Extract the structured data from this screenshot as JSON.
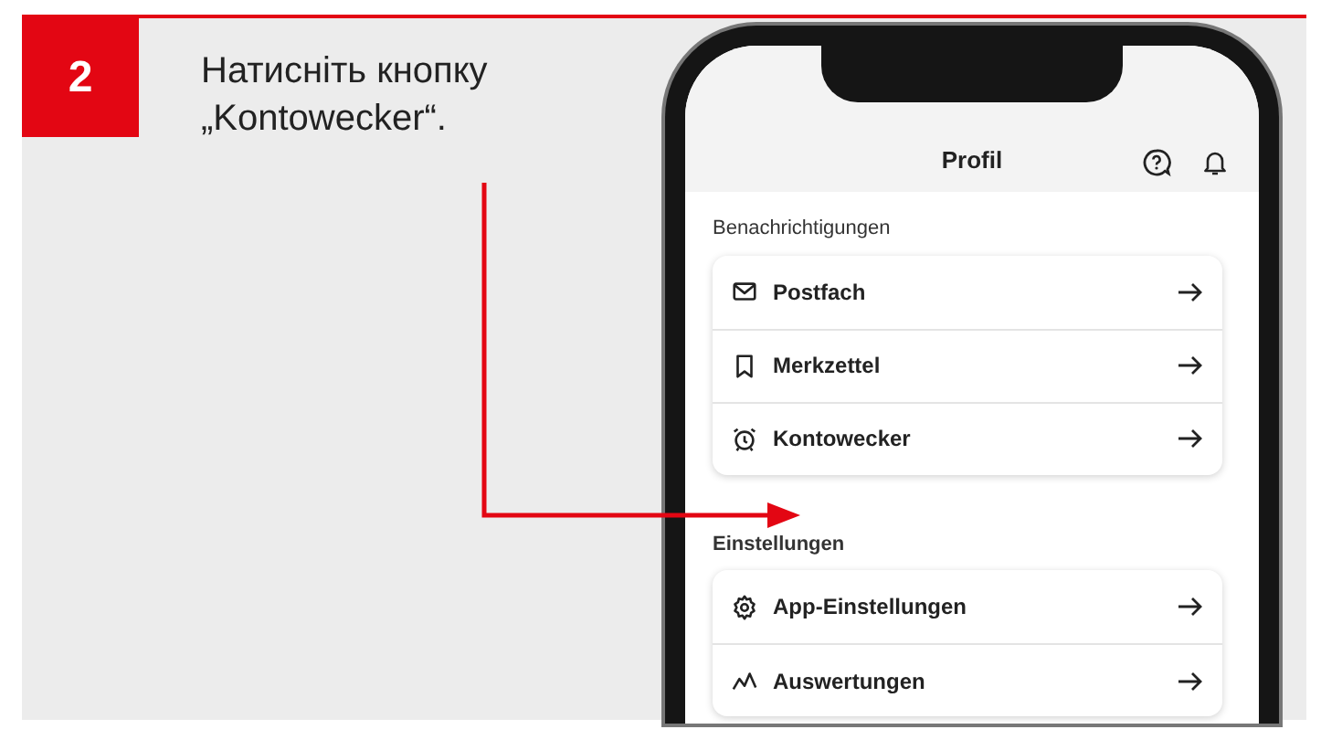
{
  "step": {
    "number": "2",
    "instruction": "Натисніть кнопку „Kontowecker“."
  },
  "phone": {
    "title": "Profil",
    "sections": [
      {
        "heading": "Benachrichtigungen",
        "items": [
          {
            "label": "Postfach"
          },
          {
            "label": "Merkzettel"
          },
          {
            "label": "Kontowecker"
          }
        ]
      },
      {
        "heading": "Einstellungen",
        "items": [
          {
            "label": "App-Einstellungen"
          },
          {
            "label": "Auswertungen"
          }
        ]
      }
    ]
  }
}
